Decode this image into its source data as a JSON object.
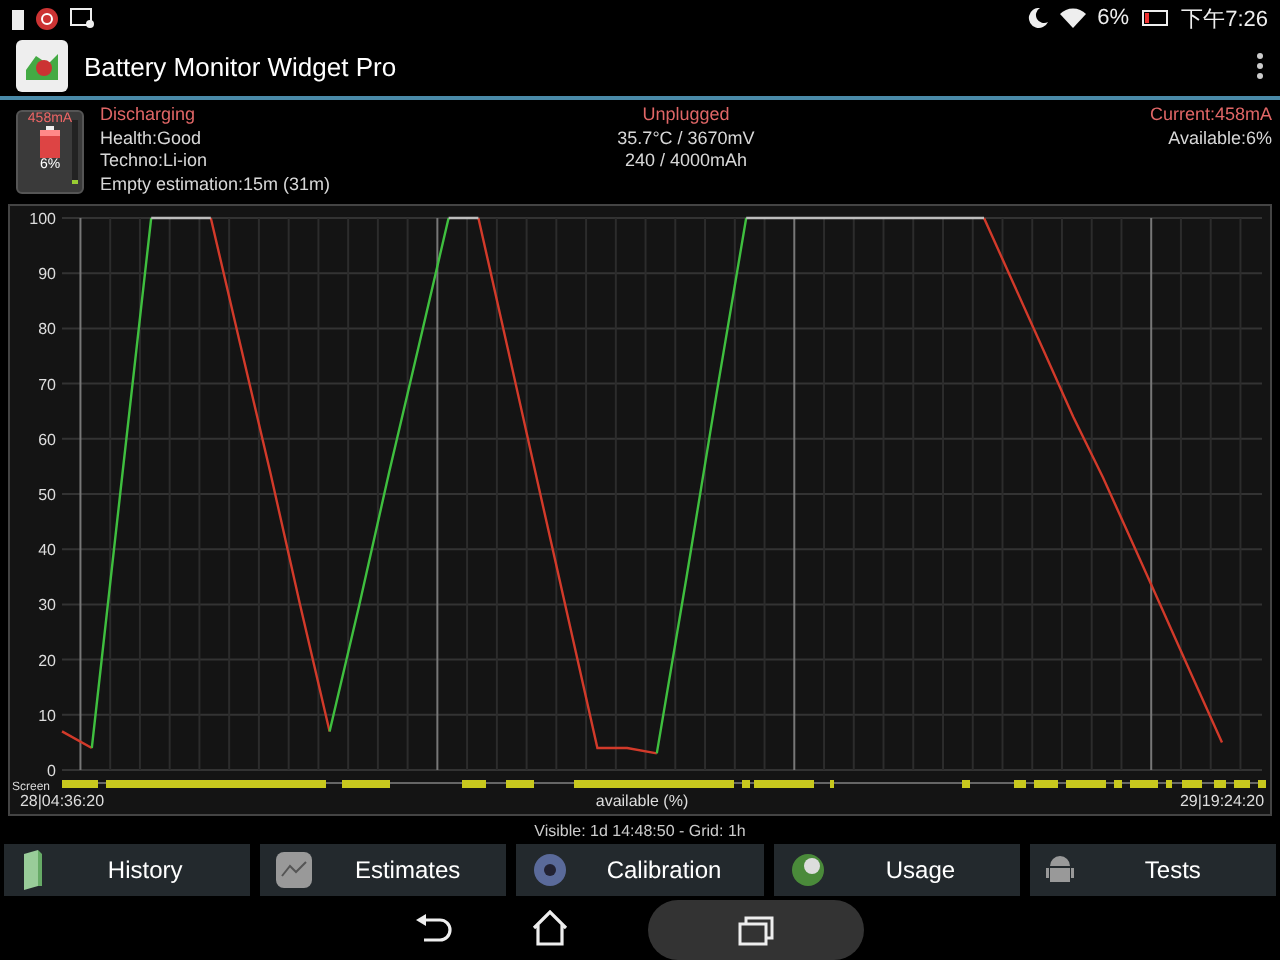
{
  "status_bar": {
    "battery_percent": "6%",
    "time": "下午7:26"
  },
  "app_bar": {
    "title": "Battery Monitor Widget Pro"
  },
  "widget": {
    "current": "458mA",
    "percent": "6%",
    "level": 0.06
  },
  "info": {
    "left": [
      {
        "kind": "status",
        "text": "Discharging"
      },
      {
        "kind": "plain",
        "text": "Health:Good"
      },
      {
        "kind": "plain",
        "text": "Techno:Li-ion"
      },
      {
        "kind": "plain",
        "text": "Empty estimation:15m (31m)"
      }
    ],
    "center": [
      {
        "kind": "status",
        "text": "Unplugged"
      },
      {
        "kind": "plain",
        "text": "35.7°C / 3670mV"
      },
      {
        "kind": "plain",
        "text": "240 / 4000mAh"
      }
    ],
    "right": [
      {
        "kind": "status",
        "text": "Current:458mA"
      },
      {
        "kind": "plain",
        "text": "Available:6%"
      }
    ]
  },
  "chart": {
    "screen_label": "Screen",
    "chart_data": {
      "type": "line",
      "grid": true,
      "xlabel": "available (%)",
      "categories": [
        "28|04:36:20",
        null,
        null,
        null,
        null,
        null,
        null,
        null,
        null,
        null,
        null,
        null,
        null,
        null,
        null,
        null,
        null,
        null,
        null,
        null,
        null,
        null,
        null,
        null,
        null,
        null,
        null,
        null,
        null,
        null,
        null,
        null,
        null,
        null,
        null,
        null,
        null,
        null,
        null,
        "29|19:24:20"
      ],
      "ylim": [
        0,
        100
      ],
      "yticks": [
        0,
        10,
        20,
        30,
        40,
        50,
        60,
        70,
        80,
        90,
        100
      ],
      "series": [
        {
          "color": "#d23a2a",
          "values": [
            7,
            4,
            null,
            null,
            null,
            100,
            77,
            54,
            30,
            7,
            null,
            null,
            null,
            null,
            100,
            76,
            52,
            28,
            4,
            4,
            3,
            null,
            null,
            null,
            null,
            null,
            null,
            null,
            null,
            null,
            null,
            100,
            88,
            76,
            64,
            53,
            41,
            29,
            17,
            5
          ]
        },
        {
          "color": "#3fbf3f",
          "values": [
            null,
            4,
            52,
            100,
            null,
            null,
            null,
            null,
            null,
            7,
            30,
            54,
            77,
            100,
            null,
            null,
            null,
            null,
            null,
            null,
            3,
            35,
            68,
            100,
            null,
            null,
            null,
            null,
            null,
            null,
            null,
            null,
            null,
            null,
            null,
            null,
            null,
            null,
            null,
            null
          ]
        },
        {
          "color": "#bdbdbd",
          "values": [
            null,
            null,
            null,
            100,
            100,
            100,
            null,
            null,
            null,
            null,
            null,
            null,
            null,
            100,
            100,
            null,
            null,
            null,
            null,
            null,
            null,
            null,
            null,
            100,
            100,
            100,
            100,
            100,
            100,
            100,
            100,
            100,
            null,
            null,
            null,
            null,
            null,
            null,
            null,
            null
          ]
        }
      ]
    }
  },
  "visible_text": "Visible: 1d 14:48:50 - Grid: 1h",
  "buttons": [
    {
      "kind": "history",
      "label": "History"
    },
    {
      "kind": "estimates",
      "label": "Estimates"
    },
    {
      "kind": "calibration",
      "label": "Calibration"
    },
    {
      "kind": "usage",
      "label": "Usage"
    },
    {
      "kind": "tests",
      "label": "Tests"
    }
  ]
}
